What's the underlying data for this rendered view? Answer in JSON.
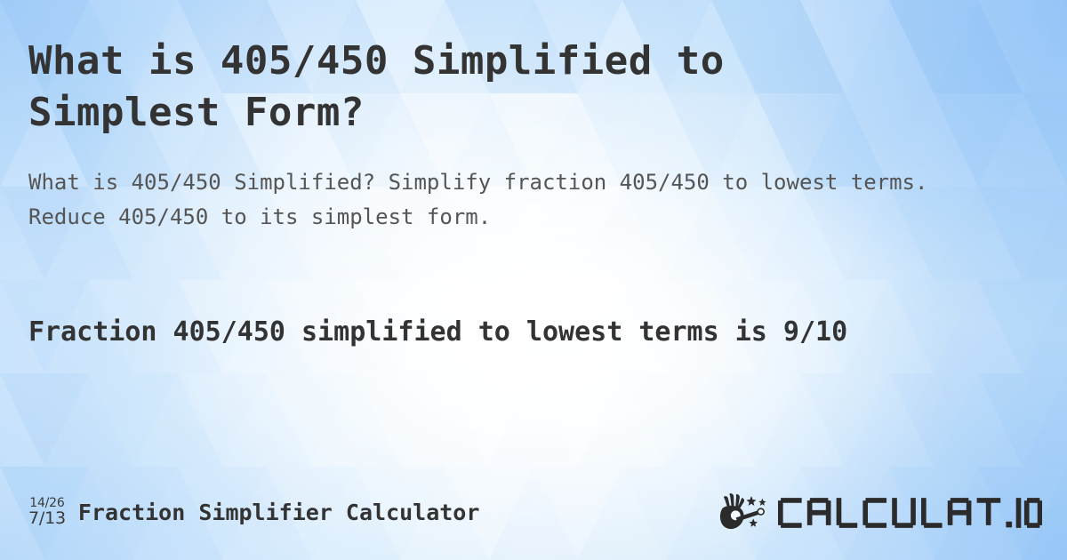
{
  "page": {
    "title": "What is 405/450 Simplified to Simplest Form?",
    "subtitle": "What is 405/450 Simplified? Simplify fraction 405/450 to lowest terms. Reduce 405/450 to its simplest form.",
    "answer": "Fraction 405/450 simplified to lowest terms is 9/10"
  },
  "fraction": {
    "numerator": "405",
    "denominator": "450",
    "original": "405/450",
    "simplified": "9/10",
    "simplified_numerator": "9",
    "simplified_denominator": "10"
  },
  "footer": {
    "badge": {
      "top": "14/26",
      "bottom": "7/13"
    },
    "tool_name": "Fraction Simplifier Calculator",
    "brand": {
      "name": "CALCULAT.IO",
      "icon": "hand-magic-wand-icon"
    }
  },
  "colors": {
    "text_primary": "#333333",
    "text_secondary": "#555555",
    "background_light": "#ffffff",
    "background_blue": "#8fc4f5",
    "background_base": "#dcecfc",
    "brand_dark": "#2b2b2b"
  }
}
